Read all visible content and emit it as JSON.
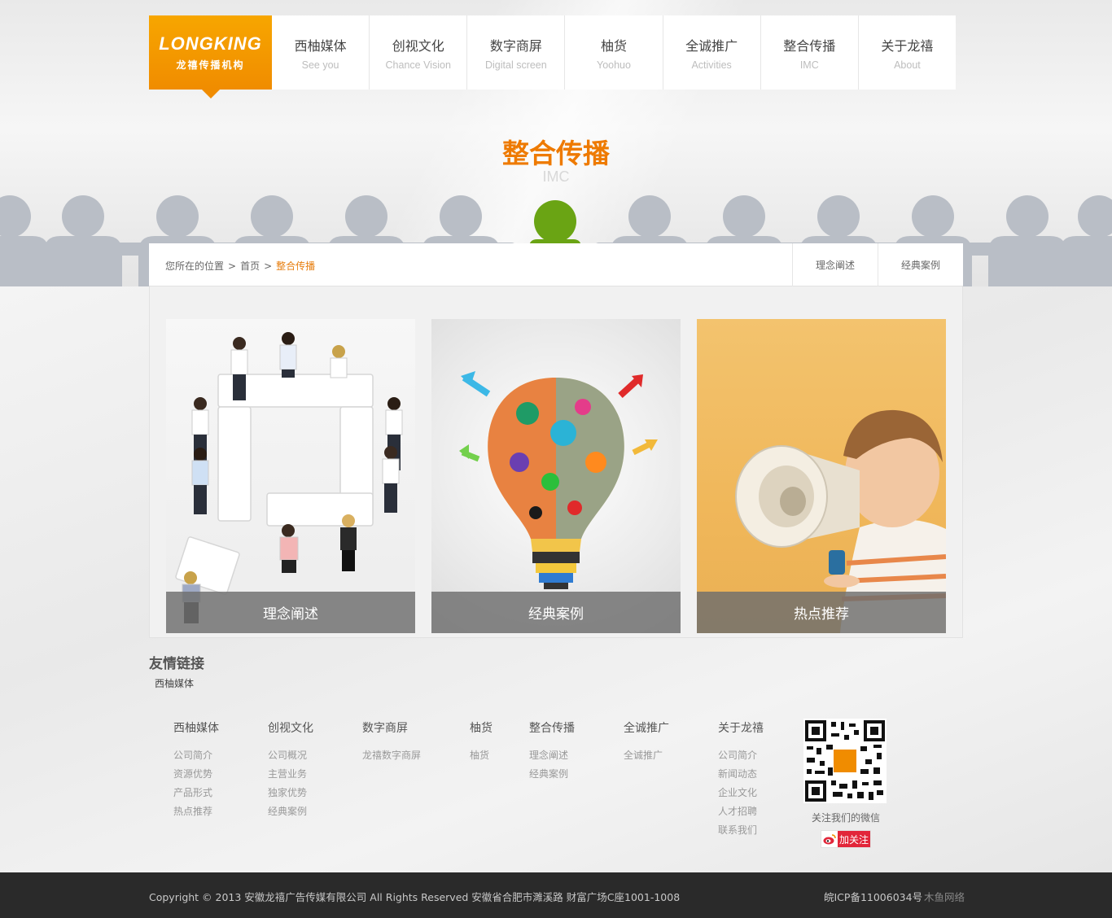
{
  "logo": {
    "brand": "LONGKING",
    "subtitle": "龙禧传播机构"
  },
  "nav": [
    {
      "zh": "西柚媒体",
      "en": "See you"
    },
    {
      "zh": "创视文化",
      "en": "Chance Vision"
    },
    {
      "zh": "数字商屏",
      "en": "Digital screen"
    },
    {
      "zh": "柚货",
      "en": "Yoohuo"
    },
    {
      "zh": "全诚推广",
      "en": "Activities"
    },
    {
      "zh": "整合传播",
      "en": "IMC"
    },
    {
      "zh": "关于龙禧",
      "en": "About"
    }
  ],
  "hero": {
    "title": "整合传播",
    "subtitle": "IMC"
  },
  "breadcrumb": {
    "prefix": "您所在的位置",
    "sep1": ">",
    "home": "首页",
    "sep2": ">",
    "current": "整合传播"
  },
  "subnav": [
    "理念阐述",
    "经典案例"
  ],
  "cards": [
    {
      "caption": "理念阐述"
    },
    {
      "caption": "经典案例"
    },
    {
      "caption": "热点推荐"
    }
  ],
  "friend_links": {
    "title": "友情链接",
    "items": [
      "西柚媒体"
    ]
  },
  "footer_columns": [
    {
      "heading": "西柚媒体",
      "links": [
        "公司简介",
        "资源优势",
        "产品形式",
        "热点推荐"
      ]
    },
    {
      "heading": "创视文化",
      "links": [
        "公司概况",
        "主营业务",
        "独家优势",
        "经典案例"
      ]
    },
    {
      "heading": "数字商屏",
      "links": [
        "龙禧数字商屏"
      ]
    },
    {
      "heading": "柚货",
      "links": [
        "柚货"
      ]
    },
    {
      "heading": "整合传播",
      "links": [
        "理念阐述",
        "经典案例"
      ]
    },
    {
      "heading": "全诚推广",
      "links": [
        "全诚推广"
      ]
    },
    {
      "heading": "关于龙禧",
      "links": [
        "公司简介",
        "新闻动态",
        "企业文化",
        "人才招聘",
        "联系我们"
      ]
    }
  ],
  "wechat": {
    "text": "关注我们的微信"
  },
  "weibo": {
    "label": "加关注"
  },
  "footer": {
    "copyright": "Copyright © 2013 安徽龙禧广告传媒有限公司  All Rights Reserved  安徽省合肥市濉溪路  财富广场C座1001-1008",
    "icp": "皖ICP备11006034号",
    "maker": "木鱼网络"
  },
  "colors": {
    "accent": "#ee7a00",
    "logo_bg": "#f7a600",
    "footer_bg": "#2a2a2a",
    "highlight_figure": "#6aa414"
  }
}
